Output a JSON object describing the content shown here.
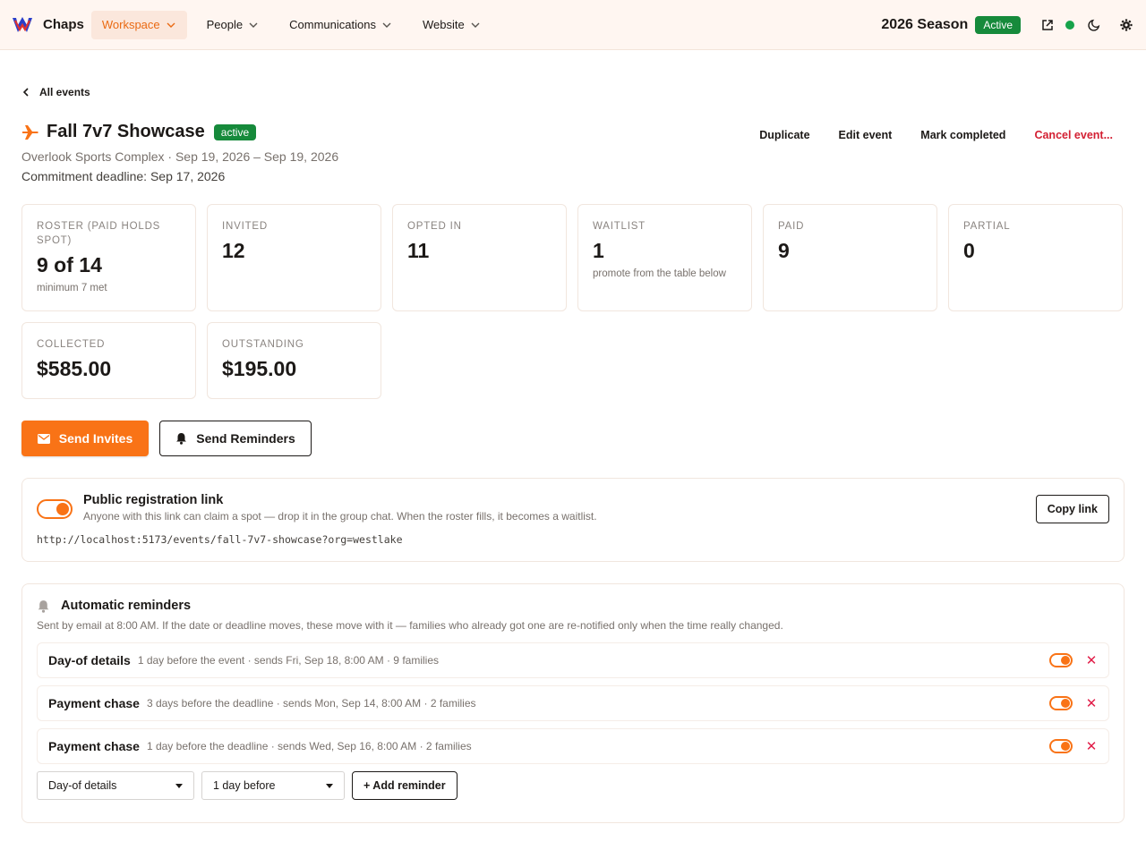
{
  "app": {
    "brand": "Chaps"
  },
  "nav": {
    "items": [
      {
        "label": "Workspace",
        "active": true
      },
      {
        "label": "People"
      },
      {
        "label": "Communications"
      },
      {
        "label": "Website"
      }
    ],
    "season": "2026 Season",
    "season_status": "Active"
  },
  "back_label": "All events",
  "event": {
    "title": "Fall 7v7 Showcase",
    "status": "active",
    "subtitle": "Overlook Sports Complex · Sep 19, 2026 – Sep 19, 2026",
    "deadline": "Commitment deadline: Sep 17, 2026"
  },
  "actions": {
    "duplicate": "Duplicate",
    "edit": "Edit event",
    "complete": "Mark completed",
    "cancel": "Cancel event..."
  },
  "stats": [
    {
      "label": "Roster (paid holds spot)",
      "value": "9 of 14",
      "note": "minimum 7 met"
    },
    {
      "label": "Invited",
      "value": "12",
      "note": ""
    },
    {
      "label": "Opted in",
      "value": "11",
      "note": ""
    },
    {
      "label": "Waitlist",
      "value": "1",
      "note": "promote from the table below"
    },
    {
      "label": "Paid",
      "value": "9",
      "note": ""
    },
    {
      "label": "Partial",
      "value": "0",
      "note": ""
    },
    {
      "label": "Collected",
      "value": "$585.00",
      "note": ""
    },
    {
      "label": "Outstanding",
      "value": "$195.00",
      "note": ""
    }
  ],
  "buttons": {
    "send_invites": "Send Invites",
    "send_reminders": "Send Reminders"
  },
  "registration": {
    "enabled": true,
    "title": "Public registration link",
    "description": "Anyone with this link can claim a spot — drop it in the group chat. When the roster fills, it becomes a waitlist.",
    "url": "http://localhost:5173/events/fall-7v7-showcase?org=westlake",
    "copy_label": "Copy link"
  },
  "reminders": {
    "title": "Automatic reminders",
    "description": "Sent by email at 8:00 AM. If the date or deadline moves, these move with it — families who already got one are re-notified only when the time really changed.",
    "items": [
      {
        "name": "Day-of details",
        "meta": "1 day before the event · sends Fri, Sep 18, 8:00 AM · 9 families",
        "enabled": true
      },
      {
        "name": "Payment chase",
        "meta": "3 days before the deadline · sends Mon, Sep 14, 8:00 AM · 2 families",
        "enabled": true
      },
      {
        "name": "Payment chase",
        "meta": "1 day before the deadline · sends Wed, Sep 16, 8:00 AM · 2 families",
        "enabled": true
      }
    ],
    "type_select": "Day-of details",
    "timing_select": "1 day before",
    "add_label": "+ Add reminder"
  },
  "colors": {
    "accent": "#f97316",
    "success": "#168a3b",
    "danger": "#d32033"
  }
}
